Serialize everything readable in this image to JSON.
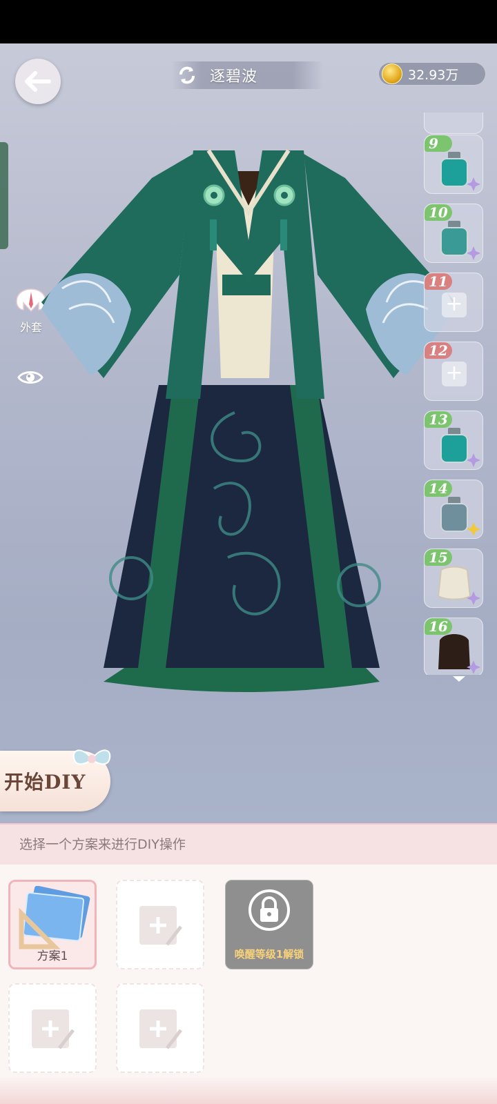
{
  "header": {
    "title": "逐碧波",
    "coins": "32.93万"
  },
  "left_menu": {
    "coat_label": "外套"
  },
  "slots": [
    {
      "num": "",
      "type": "partial"
    },
    {
      "num": "9",
      "type": "bottle",
      "badge": "purple-star"
    },
    {
      "num": "10",
      "type": "bottle",
      "badge": "purple-star"
    },
    {
      "num": "11",
      "type": "empty"
    },
    {
      "num": "12",
      "type": "empty"
    },
    {
      "num": "13",
      "type": "bottle",
      "badge": "purple-star"
    },
    {
      "num": "14",
      "type": "bottle",
      "badge": "gold-star"
    },
    {
      "num": "15",
      "type": "cape",
      "badge": "purple-star"
    },
    {
      "num": "16",
      "type": "hair",
      "badge": "purple-star"
    }
  ],
  "diy": {
    "button_label": "开始DIY"
  },
  "panel": {
    "instruction": "选择一个方案来进行DIY操作",
    "plans": [
      {
        "label": "方案1",
        "state": "selected"
      },
      {
        "label": "",
        "state": "empty"
      },
      {
        "label": "唤醒等级1解锁",
        "state": "locked"
      },
      {
        "label": "",
        "state": "empty"
      },
      {
        "label": "",
        "state": "empty"
      }
    ]
  },
  "colors": {
    "accent_pink": "#f2b4bb",
    "slot_green_badge": "#7cc46e",
    "slot_red_badge": "#d98080",
    "garment_green": "#1f6b5c"
  }
}
